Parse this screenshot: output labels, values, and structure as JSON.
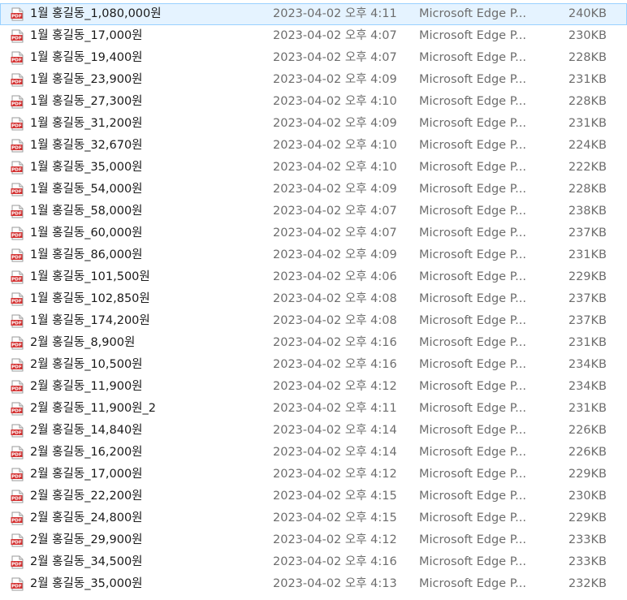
{
  "list": {
    "rows": [
      {
        "name": "1월 홍길동_1,080,000원",
        "date": "2023-04-02 오후 4:11",
        "type": "Microsoft Edge P...",
        "size": "240KB",
        "icon": "pdf-icon",
        "selected": true
      },
      {
        "name": "1월 홍길동_17,000원",
        "date": "2023-04-02 오후 4:07",
        "type": "Microsoft Edge P...",
        "size": "230KB",
        "icon": "pdf-icon"
      },
      {
        "name": "1월 홍길동_19,400원",
        "date": "2023-04-02 오후 4:07",
        "type": "Microsoft Edge P...",
        "size": "228KB",
        "icon": "pdf-icon"
      },
      {
        "name": "1월 홍길동_23,900원",
        "date": "2023-04-02 오후 4:09",
        "type": "Microsoft Edge P...",
        "size": "231KB",
        "icon": "pdf-icon"
      },
      {
        "name": "1월 홍길동_27,300원",
        "date": "2023-04-02 오후 4:10",
        "type": "Microsoft Edge P...",
        "size": "228KB",
        "icon": "pdf-icon"
      },
      {
        "name": "1월 홍길동_31,200원",
        "date": "2023-04-02 오후 4:09",
        "type": "Microsoft Edge P...",
        "size": "231KB",
        "icon": "pdf-icon"
      },
      {
        "name": "1월 홍길동_32,670원",
        "date": "2023-04-02 오후 4:10",
        "type": "Microsoft Edge P...",
        "size": "224KB",
        "icon": "pdf-icon"
      },
      {
        "name": "1월 홍길동_35,000원",
        "date": "2023-04-02 오후 4:10",
        "type": "Microsoft Edge P...",
        "size": "222KB",
        "icon": "pdf-icon"
      },
      {
        "name": "1월 홍길동_54,000원",
        "date": "2023-04-02 오후 4:09",
        "type": "Microsoft Edge P...",
        "size": "228KB",
        "icon": "pdf-icon"
      },
      {
        "name": "1월 홍길동_58,000원",
        "date": "2023-04-02 오후 4:07",
        "type": "Microsoft Edge P...",
        "size": "238KB",
        "icon": "pdf-icon"
      },
      {
        "name": "1월 홍길동_60,000원",
        "date": "2023-04-02 오후 4:07",
        "type": "Microsoft Edge P...",
        "size": "237KB",
        "icon": "pdf-icon"
      },
      {
        "name": "1월 홍길동_86,000원",
        "date": "2023-04-02 오후 4:09",
        "type": "Microsoft Edge P...",
        "size": "231KB",
        "icon": "pdf-icon"
      },
      {
        "name": "1월 홍길동_101,500원",
        "date": "2023-04-02 오후 4:06",
        "type": "Microsoft Edge P...",
        "size": "229KB",
        "icon": "pdf-icon"
      },
      {
        "name": "1월 홍길동_102,850원",
        "date": "2023-04-02 오후 4:08",
        "type": "Microsoft Edge P...",
        "size": "237KB",
        "icon": "pdf-icon"
      },
      {
        "name": "1월 홍길동_174,200원",
        "date": "2023-04-02 오후 4:08",
        "type": "Microsoft Edge P...",
        "size": "237KB",
        "icon": "pdf-icon"
      },
      {
        "name": "2월 홍길동_8,900원",
        "date": "2023-04-02 오후 4:16",
        "type": "Microsoft Edge P...",
        "size": "231KB",
        "icon": "pdf-icon"
      },
      {
        "name": "2월 홍길동_10,500원",
        "date": "2023-04-02 오후 4:16",
        "type": "Microsoft Edge P...",
        "size": "234KB",
        "icon": "pdf-icon"
      },
      {
        "name": "2월 홍길동_11,900원",
        "date": "2023-04-02 오후 4:12",
        "type": "Microsoft Edge P...",
        "size": "234KB",
        "icon": "pdf-icon"
      },
      {
        "name": "2월 홍길동_11,900원_2",
        "date": "2023-04-02 오후 4:11",
        "type": "Microsoft Edge P...",
        "size": "231KB",
        "icon": "pdf-icon"
      },
      {
        "name": "2월 홍길동_14,840원",
        "date": "2023-04-02 오후 4:14",
        "type": "Microsoft Edge P...",
        "size": "226KB",
        "icon": "pdf-icon"
      },
      {
        "name": "2월 홍길동_16,200원",
        "date": "2023-04-02 오후 4:14",
        "type": "Microsoft Edge P...",
        "size": "226KB",
        "icon": "pdf-icon"
      },
      {
        "name": "2월 홍길동_17,000원",
        "date": "2023-04-02 오후 4:12",
        "type": "Microsoft Edge P...",
        "size": "229KB",
        "icon": "pdf-icon"
      },
      {
        "name": "2월 홍길동_22,200원",
        "date": "2023-04-02 오후 4:15",
        "type": "Microsoft Edge P...",
        "size": "230KB",
        "icon": "pdf-icon"
      },
      {
        "name": "2월 홍길동_24,800원",
        "date": "2023-04-02 오후 4:15",
        "type": "Microsoft Edge P...",
        "size": "229KB",
        "icon": "pdf-icon"
      },
      {
        "name": "2월 홍길동_29,900원",
        "date": "2023-04-02 오후 4:12",
        "type": "Microsoft Edge P...",
        "size": "233KB",
        "icon": "pdf-icon"
      },
      {
        "name": "2월 홍길동_34,500원",
        "date": "2023-04-02 오후 4:16",
        "type": "Microsoft Edge P...",
        "size": "233KB",
        "icon": "pdf-icon"
      },
      {
        "name": "2월 홍길동_35,000원",
        "date": "2023-04-02 오후 4:13",
        "type": "Microsoft Edge P...",
        "size": "232KB",
        "icon": "pdf-icon"
      }
    ]
  },
  "colors": {
    "selected_bg": "#e5f3ff",
    "selected_border": "#99d1ff",
    "pdf_red": "#d32f2f"
  }
}
